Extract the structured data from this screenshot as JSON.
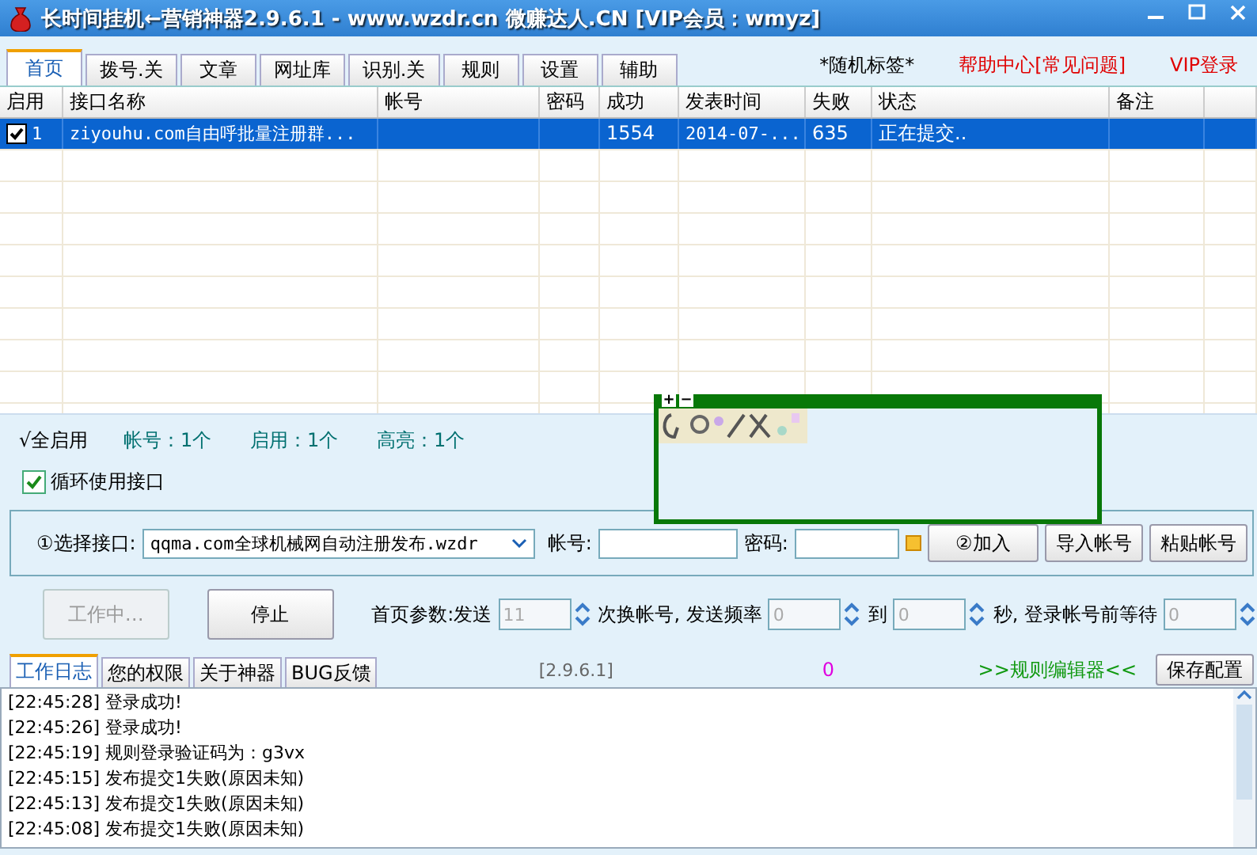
{
  "window": {
    "title": "长时间挂机←营销神器2.9.6.1 - www.wzdr.cn 微赚达人.CN [VIP会员：wmyz]"
  },
  "tabs": [
    {
      "label": "首页",
      "selected": true
    },
    {
      "label": "拨号.关",
      "selected": false
    },
    {
      "label": "文章",
      "selected": false
    },
    {
      "label": "网址库",
      "selected": false
    },
    {
      "label": "识别.关",
      "selected": false
    },
    {
      "label": "规则",
      "selected": false
    },
    {
      "label": "设置",
      "selected": false
    },
    {
      "label": "辅助",
      "selected": false
    }
  ],
  "header_links": [
    {
      "text": "*随机标签*",
      "kind": "plain"
    },
    {
      "text": "帮助中心[常见问题]",
      "kind": "link"
    },
    {
      "text": "VIP登录",
      "kind": "link"
    }
  ],
  "table": {
    "columns": [
      "启用",
      "接口名称",
      "帐号",
      "密码",
      "成功",
      "发表时间",
      "失败",
      "状态",
      "备注"
    ],
    "rows": [
      {
        "enabled": true,
        "selected": true,
        "cells": [
          "1",
          "ziyouhu.com自由呼批量注册群...",
          "",
          "",
          "1554",
          "2014-07-...",
          "635",
          "正在提交..",
          ""
        ]
      }
    ]
  },
  "summary": {
    "all_enabled": "√全启用",
    "stats": [
      "帐号：1个",
      "启用：1个",
      "高亮：1个"
    ]
  },
  "loop_interface": {
    "label": "循环使用接口",
    "checked": true
  },
  "captcha": {
    "zoom_in": "+",
    "zoom_out": "−"
  },
  "interface_form": {
    "select_label": "①选择接口:",
    "select_value": "qqma.com全球机械网自动注册发布.wzdr",
    "account_label": "帐号:",
    "password_label": "密码:",
    "buttons": [
      "②加入",
      "导入帐号",
      "粘贴帐号"
    ]
  },
  "controls": {
    "buttons": [
      {
        "label": "工作中…",
        "disabled": true
      },
      {
        "label": "停止",
        "disabled": false
      }
    ],
    "params_label": "首页参数:发送",
    "send_count": "11",
    "switch_label": "次换帐号, 发送频率",
    "freq_from": "0",
    "to_label": "到",
    "freq_to": "0",
    "wait_label": "秒, 登录帐号前等待",
    "wait": "0"
  },
  "bottom_tabs": [
    {
      "label": "工作日志",
      "selected": true
    },
    {
      "label": "您的权限",
      "selected": false
    },
    {
      "label": "关于神器",
      "selected": false
    },
    {
      "label": "BUG反馈",
      "selected": false
    }
  ],
  "version": "[2.9.6.1]",
  "counter": "0",
  "rule_editor": ">>规则编辑器<<",
  "save_button": "保存配置",
  "log": [
    "[22:45:28] 登录成功!",
    "[22:45:26] 登录成功!",
    "[22:45:19] 规则登录验证码为：g3vx",
    "[22:45:15] 发布提交1失败(原因未知)",
    "[22:45:13] 发布提交1失败(原因未知)",
    "[22:45:08] 发布提交1失败(原因未知)"
  ]
}
